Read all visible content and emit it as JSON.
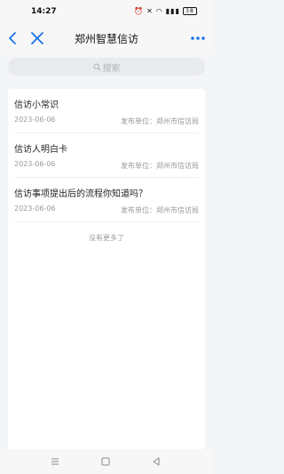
{
  "status_bar": {
    "time": "14:27",
    "battery": "38"
  },
  "header": {
    "title": "郑州智慧信访",
    "back_icon": "chevron-left-icon",
    "close_icon": "close-icon",
    "more_icon": "more-dots-icon",
    "accent_color": "#1a73e8"
  },
  "search": {
    "placeholder": "搜索",
    "icon": "search-icon"
  },
  "list": {
    "items": [
      {
        "title": "信访小常识",
        "date": "2023-06-06",
        "publisher": "发布单位：郑州市信访局"
      },
      {
        "title": "信访人明白卡",
        "date": "2023-06-06",
        "publisher": "发布单位：郑州市信访局"
      },
      {
        "title": "信访事项提出后的流程你知道吗？",
        "date": "2023-06-06",
        "publisher": "发布单位：郑州市信访局"
      }
    ],
    "end_text": "没有更多了"
  },
  "system_nav": {
    "menu_icon": "menu-icon",
    "home_icon": "home-icon",
    "back_icon": "back-triangle-icon"
  }
}
